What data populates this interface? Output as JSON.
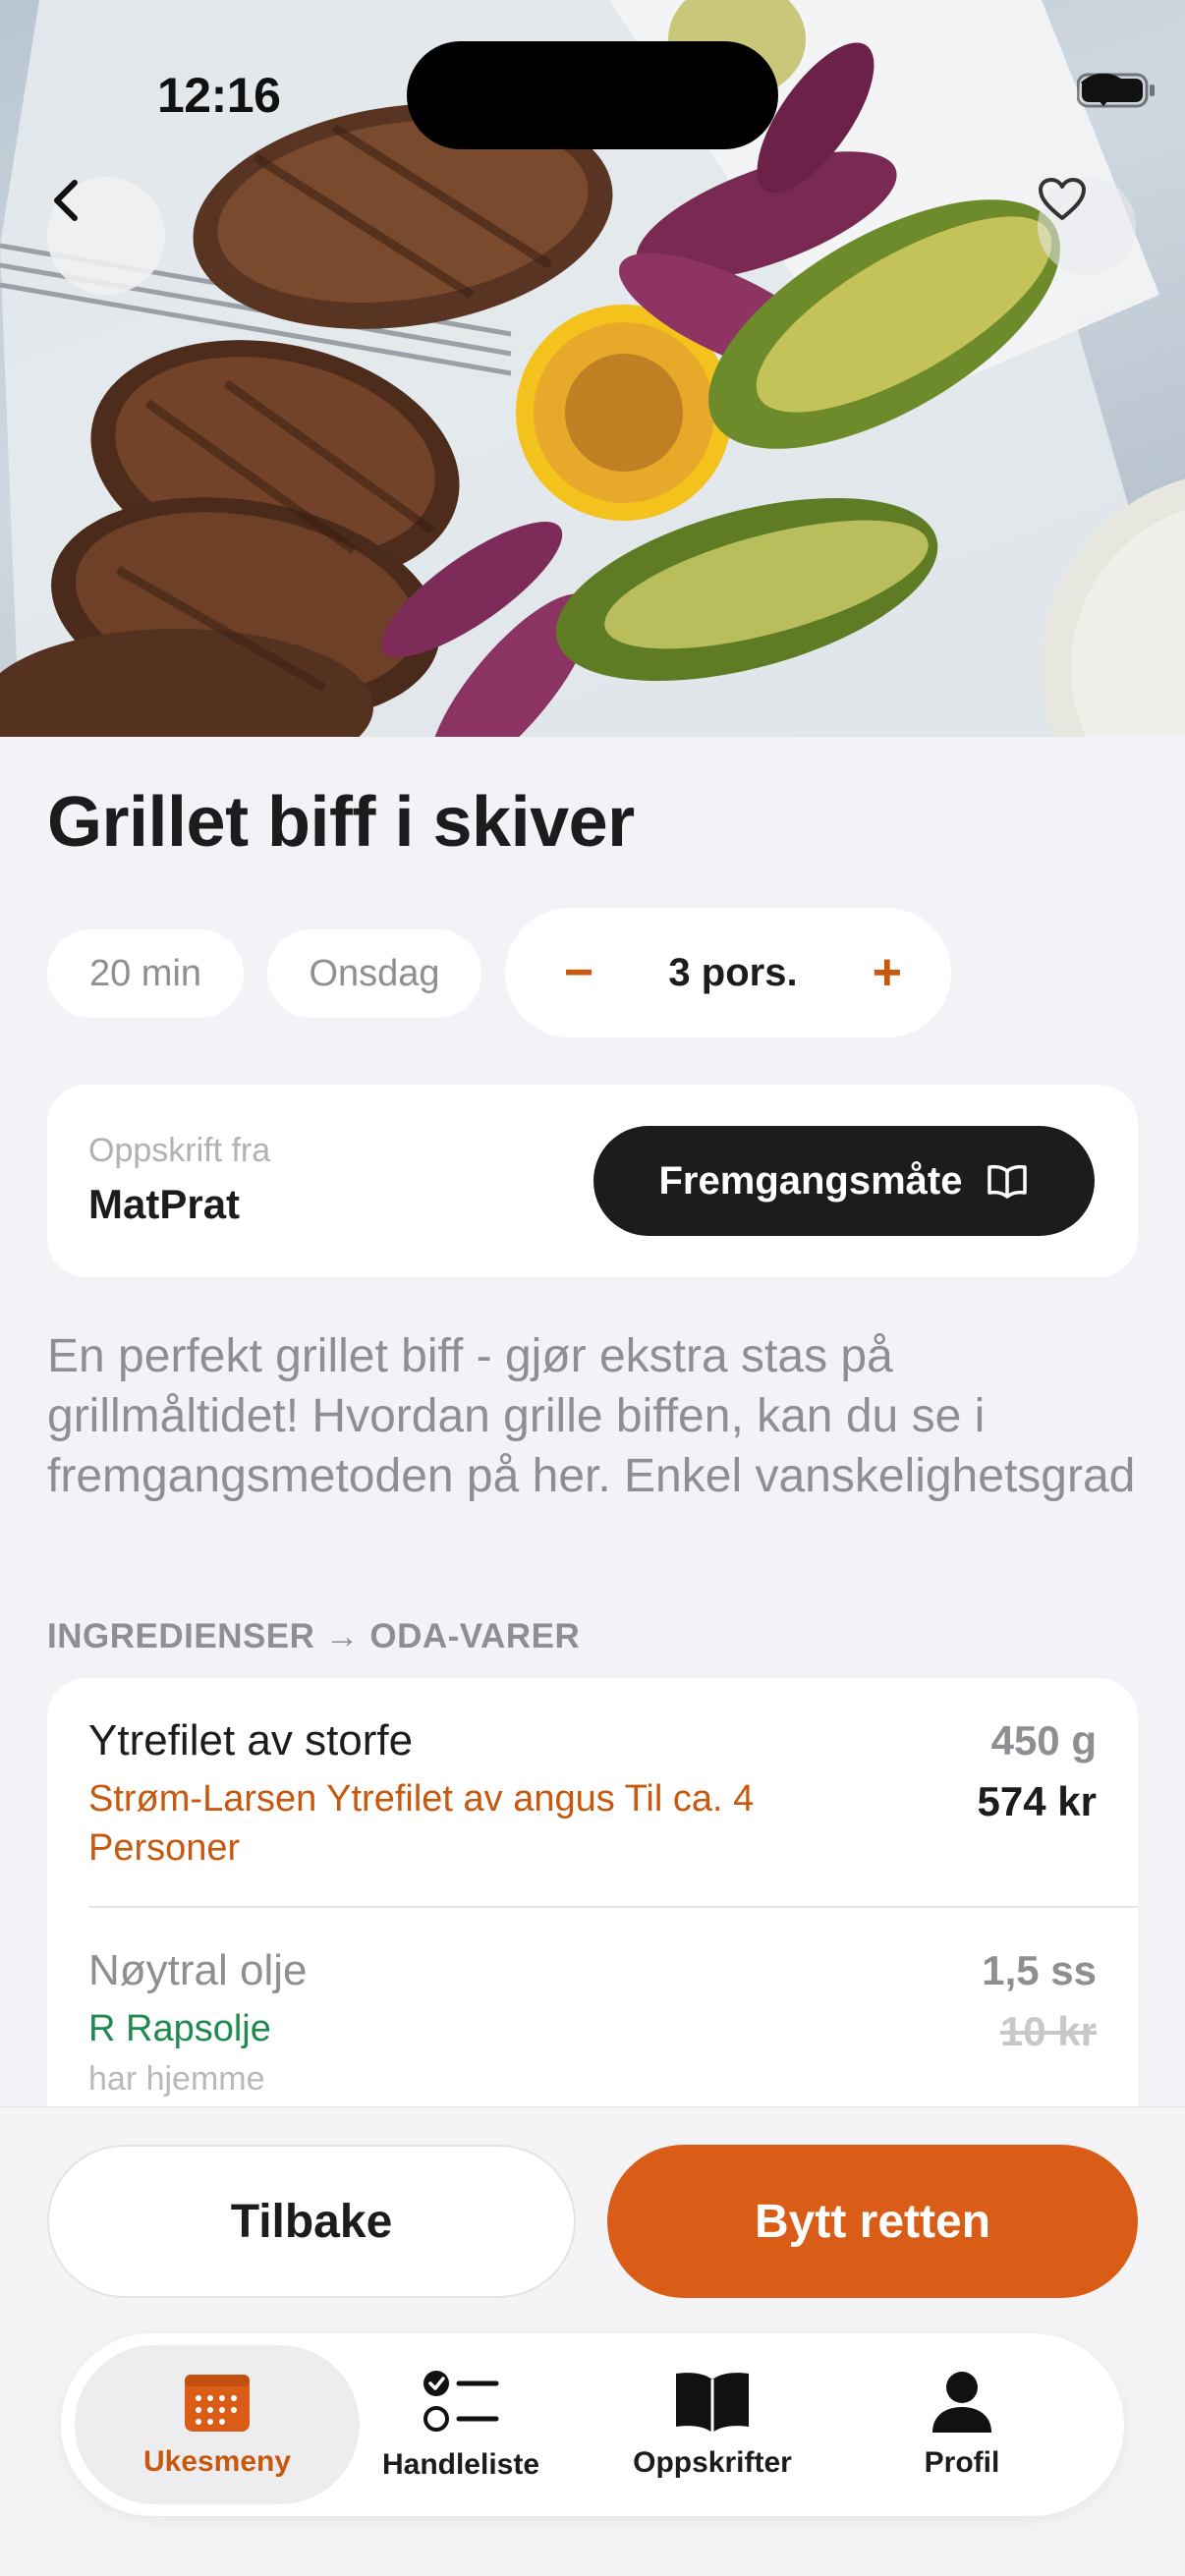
{
  "status_bar": {
    "time": "12:16"
  },
  "recipe": {
    "title": "Grillet biff i skiver",
    "time_chip": "20 min",
    "day_chip": "Onsdag",
    "portions": "3 pors.",
    "source_label": "Oppskrift fra",
    "source_name": "MatPrat",
    "method_button": "Fremgangsmåte",
    "description": "En perfekt grillet biff - gjør ekstra stas på grillmåltidet! Hvordan grille biffen, kan du se i fremgangsmetoden på her. Enkel vanskelighetsgrad"
  },
  "ingredients": {
    "header": "INGREDIENSER → ODA-VARER",
    "items": [
      {
        "name": "Ytrefilet av storfe",
        "product": "Strøm-Larsen Ytrefilet av angus Til ca. 4 Personer",
        "quantity": "450 g",
        "price": "574 kr",
        "note": ""
      },
      {
        "name": "Nøytral olje",
        "product": "R Rapsolje",
        "quantity": "1,5 ss",
        "price": "10 kr",
        "note": "har hjemme"
      }
    ]
  },
  "actions": {
    "back": "Tilbake",
    "swap": "Bytt retten"
  },
  "tabs": [
    {
      "label": "Ukesmeny",
      "icon": "calendar-icon",
      "active": true
    },
    {
      "label": "Handleliste",
      "icon": "checklist-icon",
      "active": false
    },
    {
      "label": "Oppskrifter",
      "icon": "book-icon",
      "active": false
    },
    {
      "label": "Profil",
      "icon": "person-icon",
      "active": false
    }
  ],
  "colors": {
    "accent": "#d95d16",
    "accent_text": "#c9580f",
    "green": "#1e8a4f",
    "background": "#f2f2f7"
  }
}
